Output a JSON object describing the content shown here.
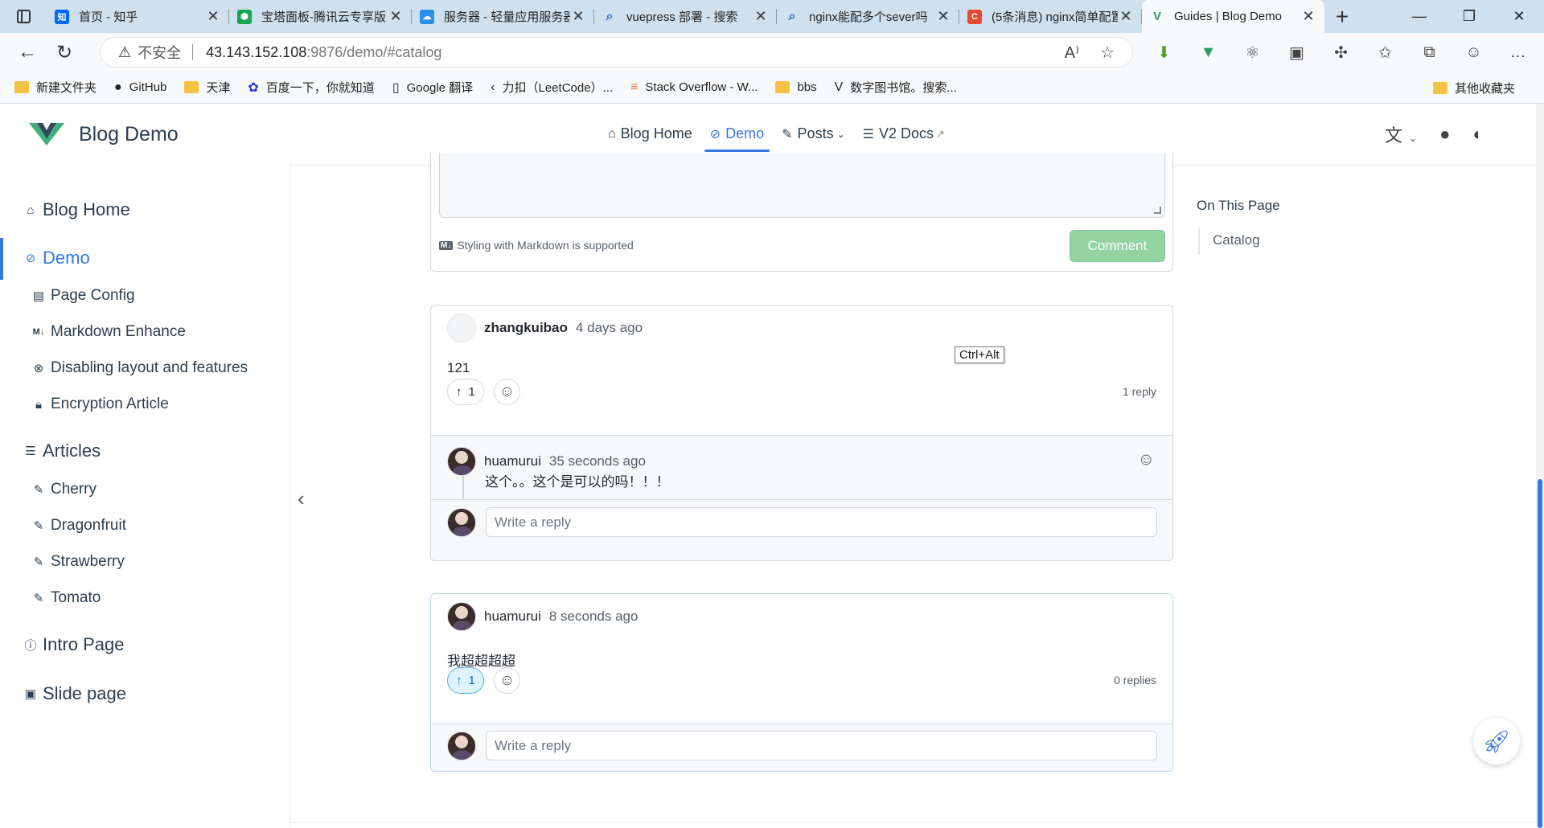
{
  "browser": {
    "tabs": [
      {
        "title": "首页 - 知乎",
        "fav": "知",
        "favcolor": "#0066ff"
      },
      {
        "title": "宝塔面板-腾讯云专享版",
        "fav": "⬢",
        "favcolor": "#1aa350"
      },
      {
        "title": "服务器 - 轻量应用服务器",
        "fav": "☁",
        "favcolor": "#2a8fe8"
      },
      {
        "title": "vuepress 部署 - 搜索",
        "fav": "⌕",
        "favcolor": "#2a5fd6"
      },
      {
        "title": "nginx能配多个sever吗",
        "fav": "⌕",
        "favcolor": "#2a5fd6"
      },
      {
        "title": "(5条消息) nginx简单配置",
        "fav": "C",
        "favcolor": "#e8492f"
      },
      {
        "title": "Guides | Blog Demo",
        "fav": "V",
        "favcolor": "#2f9c6a"
      }
    ],
    "url": {
      "insecure_label": "不安全",
      "host": "43.143.152.108",
      "path": ":9876/demo/#catalog"
    },
    "bookmarks": [
      {
        "label": "新建文件夹",
        "icon": "folder-icon"
      },
      {
        "label": "GitHub",
        "icon": "github-icon"
      },
      {
        "label": "天津",
        "icon": "folder-icon"
      },
      {
        "label": "百度一下，你就知道",
        "icon": "baidu-icon"
      },
      {
        "label": "Google 翻译",
        "icon": "page-icon"
      },
      {
        "label": "力扣（LeetCode）...",
        "icon": "leetcode-icon"
      },
      {
        "label": "Stack Overflow - W...",
        "icon": "stackoverflow-icon"
      },
      {
        "label": "bbs",
        "icon": "folder-icon"
      },
      {
        "label": "数字图书馆。搜索...",
        "icon": "v-icon"
      }
    ],
    "other_bookmarks": "其他收藏夹"
  },
  "site": {
    "brand": "Blog Demo",
    "nav": [
      {
        "label": "Blog Home",
        "icon": "home-icon",
        "active": false
      },
      {
        "label": "Demo",
        "icon": "demo-icon",
        "active": true
      },
      {
        "label": "Posts",
        "icon": "edit-icon",
        "active": false,
        "dropdown": true
      },
      {
        "label": "V2 Docs",
        "icon": "docs-icon",
        "active": false,
        "external": true
      }
    ]
  },
  "sidebar": {
    "items": [
      {
        "label": "Blog Home",
        "icon": "home-icon",
        "level": "top",
        "active": false
      },
      {
        "label": "Demo",
        "icon": "demo-icon",
        "level": "top",
        "active": true
      },
      {
        "label": "Page Config",
        "icon": "config-icon",
        "level": "sub"
      },
      {
        "label": "Markdown Enhance",
        "icon": "markdown-icon",
        "level": "sub"
      },
      {
        "label": "Disabling layout and features",
        "icon": "disable-icon",
        "level": "sub"
      },
      {
        "label": "Encryption Article",
        "icon": "lock-icon",
        "level": "sub"
      },
      {
        "label": "Articles",
        "icon": "articles-icon",
        "level": "top"
      },
      {
        "label": "Cherry",
        "icon": "edit-icon",
        "level": "sub"
      },
      {
        "label": "Dragonfruit",
        "icon": "edit-icon",
        "level": "sub"
      },
      {
        "label": "Strawberry",
        "icon": "edit-icon",
        "level": "sub"
      },
      {
        "label": "Tomato",
        "icon": "edit-icon",
        "level": "sub"
      },
      {
        "label": "Intro Page",
        "icon": "info-icon",
        "level": "top"
      },
      {
        "label": "Slide page",
        "icon": "slide-icon",
        "level": "top"
      }
    ]
  },
  "editor": {
    "markdown_note": "Styling with Markdown is supported",
    "markdown_badge": "M↓",
    "comment_button": "Comment"
  },
  "comments": [
    {
      "author": "zhangkuibao",
      "time": "4 days ago",
      "body": "121",
      "upvotes": "1",
      "replies_label": "1 reply",
      "replies": [
        {
          "author": "huamurui",
          "time": "35 seconds ago",
          "body": "这个。。这个是可以的吗！！！"
        }
      ],
      "reply_placeholder": "Write a reply"
    },
    {
      "author": "huamurui",
      "time": "8 seconds ago",
      "body": "我超超超超",
      "upvotes": "1",
      "replies_label": "0 replies",
      "reply_placeholder": "Write a reply"
    }
  ],
  "tooltip": "Ctrl+Alt",
  "toc": {
    "title": "On This Page",
    "items": [
      "Catalog"
    ]
  },
  "colors": {
    "accent": "#3578e5",
    "comment_button": "#94d3a2"
  }
}
